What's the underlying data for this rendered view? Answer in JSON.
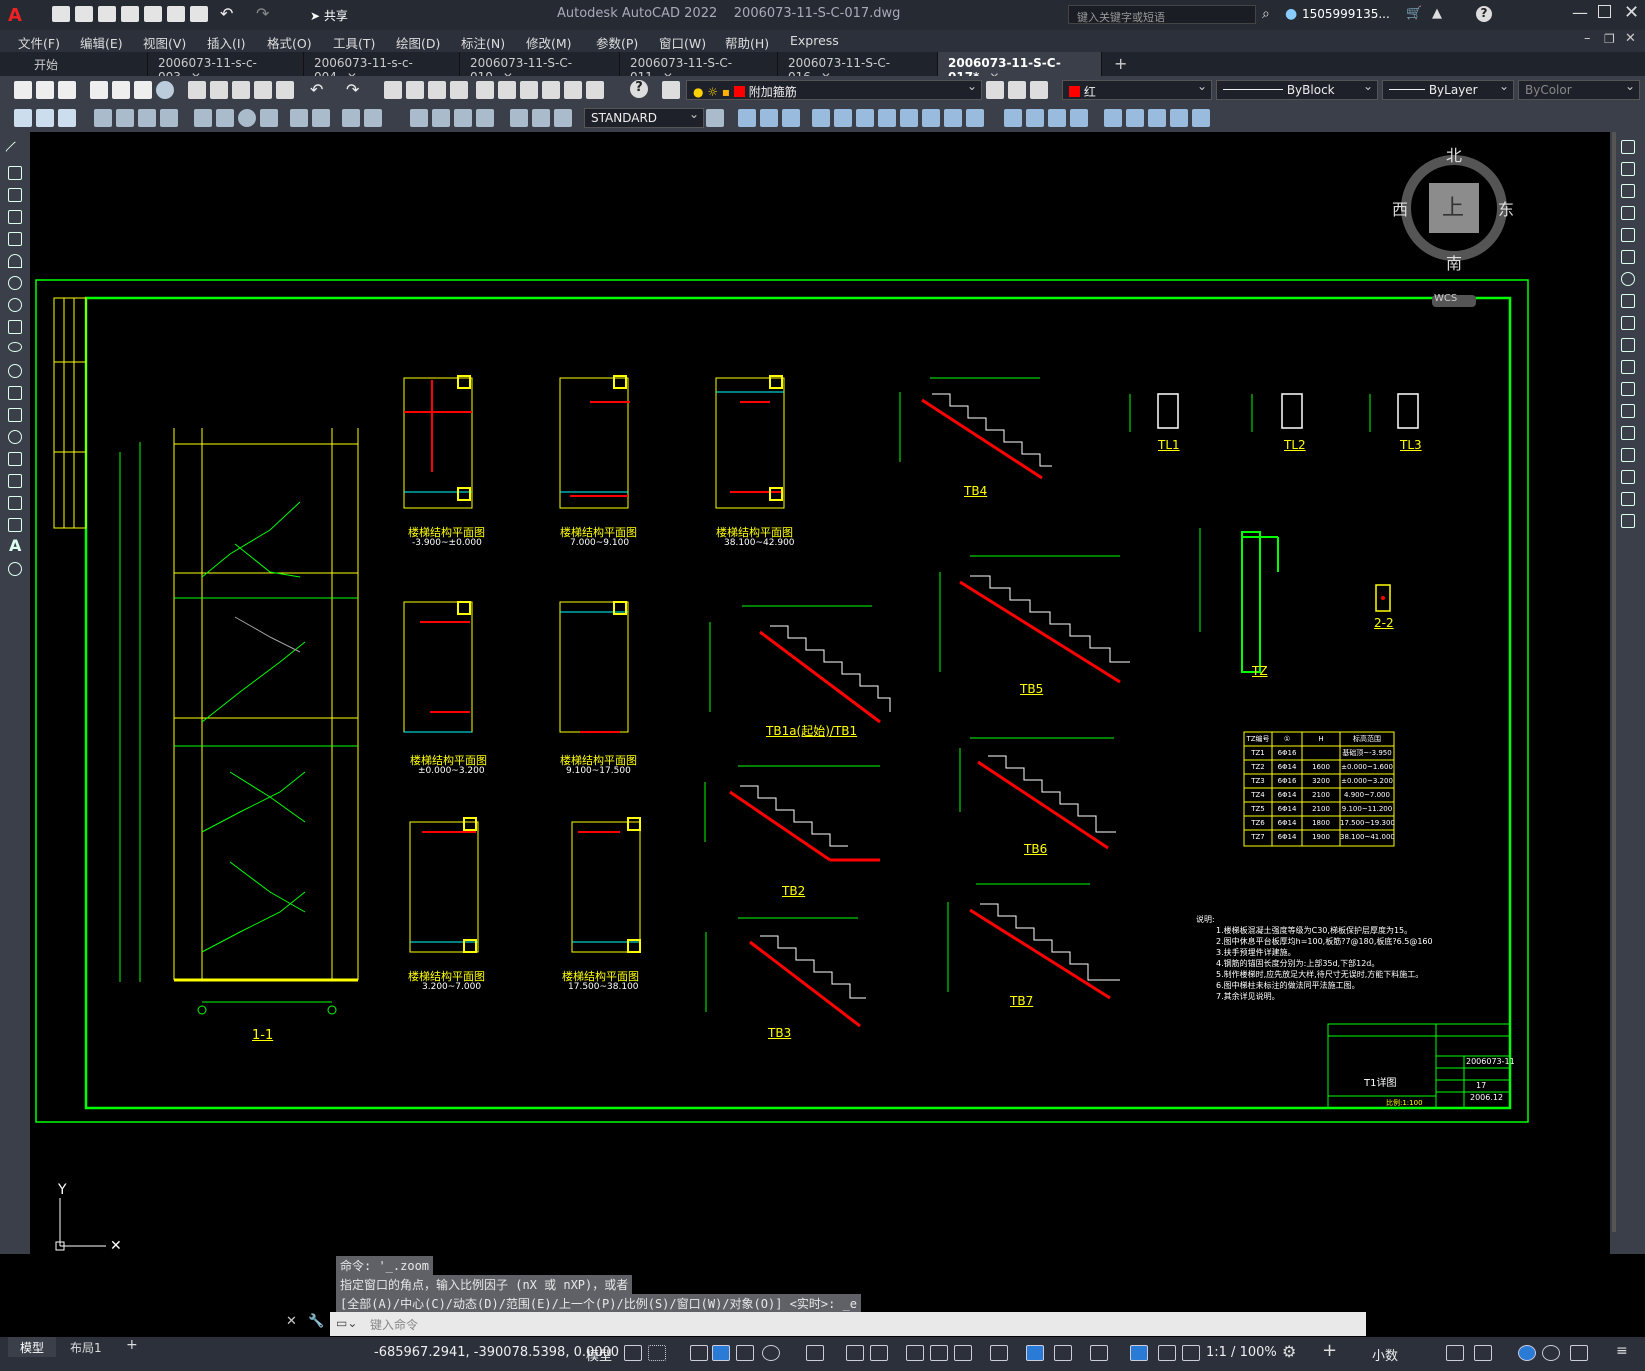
{
  "title": {
    "app": "Autodesk AutoCAD 2022",
    "file": "2006073-11-S-C-017.dwg",
    "share_label": "共享",
    "search_placeholder": "键入关键字或短语",
    "user": "1505999135..."
  },
  "menu": [
    "文件(F)",
    "编辑(E)",
    "视图(V)",
    "插入(I)",
    "格式(O)",
    "工具(T)",
    "绘图(D)",
    "标注(N)",
    "修改(M)",
    "参数(P)",
    "窗口(W)",
    "帮助(H)",
    "Express"
  ],
  "tabs": [
    "开始",
    "2006073-11-s-c-003",
    "2006073-11-s-c-004",
    "2006073-11-S-C-010",
    "2006073-11-S-C-011",
    "2006073-11-S-C-016",
    "2006073-11-S-C-017*"
  ],
  "toolbar": {
    "layer": "附加箍筋",
    "color": "红",
    "linetype": "ByBlock",
    "lineweight": "ByLayer",
    "plotstyle": "ByColor",
    "textstyle": "STANDARD"
  },
  "viewcube": {
    "north": "北",
    "south": "南",
    "east": "东",
    "west": "西",
    "top": "上",
    "wcs": "WCS"
  },
  "drawing": {
    "section": "1-1",
    "plans": [
      "楼梯结构平面图",
      "楼梯结构平面图",
      "楼梯结构平面图",
      "楼梯结构平面图",
      "楼梯结构平面图",
      "楼梯结构平面图",
      "楼梯结构平面图"
    ],
    "plan_ranges": [
      "-3.900~±0.000",
      "7.000~9.100",
      "38.100~42.900",
      "±0.000~3.200",
      "9.100~17.500",
      "3.200~7.000",
      "17.500~38.100"
    ],
    "tb_labels": [
      "TB4",
      "TB1a(起始)/TB1",
      "TB5",
      "TB2",
      "TB6",
      "TB3",
      "TB7"
    ],
    "tl_labels": [
      "TL1",
      "TL2",
      "TL3"
    ],
    "tz_label": "TZ",
    "section22": "2-2",
    "tz_table": {
      "headers": [
        "TZ编号",
        "①",
        "H",
        "标高范围"
      ],
      "rows": [
        [
          "TZ1",
          "6Φ16",
          "",
          "基础顶~-3.950"
        ],
        [
          "TZ2",
          "6Φ14",
          "1600",
          "±0.000~1.600"
        ],
        [
          "TZ3",
          "6Φ16",
          "3200",
          "±0.000~3.200"
        ],
        [
          "TZ4",
          "6Φ14",
          "2100",
          "4.900~7.000"
        ],
        [
          "TZ5",
          "6Φ14",
          "2100",
          "9.100~11.200"
        ],
        [
          "TZ6",
          "6Φ14",
          "1800",
          "17.500~19.300"
        ],
        [
          "TZ7",
          "6Φ14",
          "1900",
          "38.100~41.000"
        ]
      ]
    },
    "notes_title": "说明:",
    "notes": [
      "1.楼梯板混凝土强度等级为C30,梯板保护层厚度为15。",
      "2.图中休息平台板厚均h=100,板筋?7@180,板底?6.5@160",
      "3.扶手预埋件详建施。",
      "4.钢筋的锚固长度分别为:上部35d,下部12d。",
      "5.制作楼梯时,应先放足大样,待尺寸无误时,方能下料施工。",
      "6.图中梯柱未标注的做法同平法施工图。",
      "7.其余详见说明。"
    ],
    "titleblock": {
      "drawing_name": "T1详图",
      "project_no": "2006073-11",
      "sheet": "17",
      "date": "2006.12",
      "scale": "比例:1:100"
    }
  },
  "command": {
    "history": [
      "命令: '_.zoom",
      "指定窗口的角点，输入比例因子 (nX 或 nXP)，或者",
      "[全部(A)/中心(C)/动态(D)/范围(E)/上一个(P)/比例(S)/窗口(W)/对象(O)] <实时>: _e"
    ],
    "placeholder": "键入命令"
  },
  "status": {
    "layout_tabs": [
      "模型",
      "布局1"
    ],
    "coords": "-685967.2941, -390078.5398, 0.0000",
    "model": "模型",
    "scale": "1:1 / 100%",
    "units": "小数"
  },
  "colors": {
    "drawing_border": "#00ff00",
    "highlight_red": "#ff0000",
    "dim_green": "#00ff00",
    "text_yellow": "#ffff00"
  }
}
